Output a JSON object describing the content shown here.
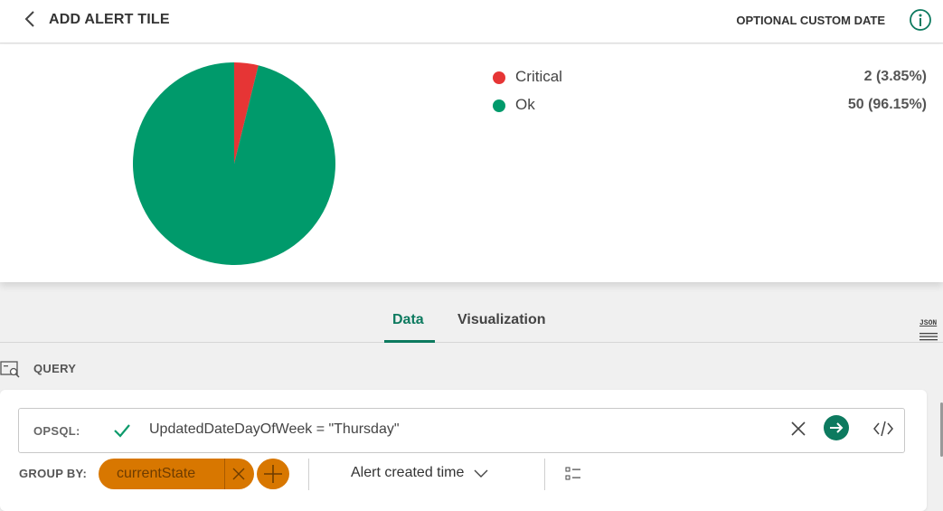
{
  "header": {
    "title": "ADD ALERT TILE",
    "custom_date_label": "OPTIONAL CUSTOM DATE",
    "icons": {
      "back": "chevron-left-icon",
      "info": "info-icon"
    }
  },
  "chart_data": {
    "type": "pie",
    "categories": [
      "Critical",
      "Ok"
    ],
    "values": [
      2,
      50
    ],
    "percentages": [
      3.85,
      96.15
    ],
    "colors": [
      "#e63535",
      "#009a6b"
    ],
    "legend_placement": "right"
  },
  "legend": [
    {
      "label": "Critical",
      "value": "2  (3.85%)",
      "color": "#e63535"
    },
    {
      "label": "Ok",
      "value": "50  (96.15%)",
      "color": "#009a6b"
    }
  ],
  "tabs": [
    {
      "label": "Data",
      "active": true
    },
    {
      "label": "Visualization",
      "active": false
    }
  ],
  "json_button_label": "JSON",
  "query": {
    "section_label": "QUERY",
    "opsql_label": "OPSQL:",
    "opsql_value": "UpdatedDateDayOfWeek = \"Thursday\"",
    "group_by_label": "GROUP BY:",
    "group_by_chip": "currentState",
    "sort_label": "Alert created time"
  },
  "colors": {
    "accent": "#0d7a5f",
    "chip": "#d87700",
    "critical": "#e63535",
    "ok": "#009a6b"
  }
}
